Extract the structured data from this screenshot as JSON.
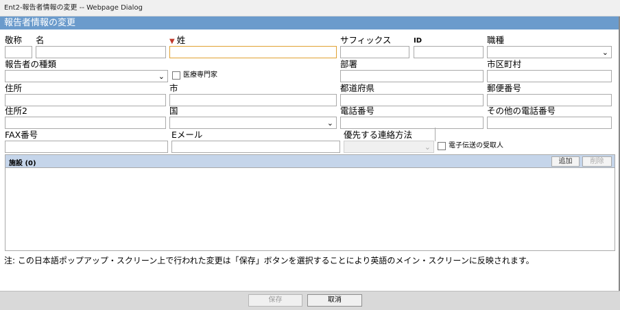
{
  "window": {
    "title": "Ent2-報告者情報の変更 -- Webpage Dialog"
  },
  "section": {
    "title": "報告者情報の変更"
  },
  "form": {
    "honorific": {
      "label": "敬称",
      "value": ""
    },
    "first_name": {
      "label": "名",
      "value": ""
    },
    "last_name": {
      "label": "姓",
      "value": ""
    },
    "suffix": {
      "label": "サフィックス",
      "value": ""
    },
    "id": {
      "label": "ID",
      "value": ""
    },
    "occupation": {
      "label": "職種",
      "selected": ""
    },
    "reporter_type": {
      "label": "報告者の種類",
      "selected": ""
    },
    "health_professional": {
      "label": "医療専門家",
      "checked": false
    },
    "department": {
      "label": "部署",
      "value": ""
    },
    "city_ward": {
      "label": "市区町村",
      "value": ""
    },
    "address": {
      "label": "住所",
      "value": ""
    },
    "city": {
      "label": "市",
      "value": ""
    },
    "prefecture": {
      "label": "都道府県",
      "value": ""
    },
    "postal_code": {
      "label": "郵便番号",
      "value": ""
    },
    "address2": {
      "label": "住所2",
      "value": ""
    },
    "country": {
      "label": "国",
      "selected": ""
    },
    "phone": {
      "label": "電話番号",
      "value": ""
    },
    "other_phone": {
      "label": "その他の電話番号",
      "value": ""
    },
    "fax": {
      "label": "FAX番号",
      "value": ""
    },
    "email": {
      "label": "Eメール",
      "value": ""
    },
    "preferred_contact": {
      "label": "優先する連絡方法",
      "selected": ""
    },
    "e2b_recipient": {
      "label": "電子伝送の受取人",
      "checked": false
    }
  },
  "facility": {
    "title": "施設 (0)",
    "add_label": "追加",
    "delete_label": "削除"
  },
  "note": "注: この日本語ポップアップ・スクリーン上で行われた変更は「保存」ボタンを選択することにより英語のメイン・スクリーンに反映されます。",
  "footer": {
    "save_label": "保存",
    "cancel_label": "取消"
  },
  "icons": {
    "required": "required-marker-icon",
    "dropdown": "chevron-down-icon"
  },
  "colors": {
    "header_bg": "#6b9bcc",
    "subheader_bg": "#c5d5ea",
    "required_marker": "#c0392b",
    "focus_border": "#e0a030"
  }
}
